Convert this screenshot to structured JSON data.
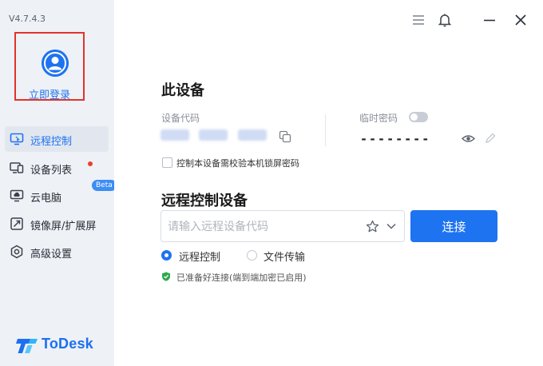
{
  "app": {
    "version": "V4.7.4.3",
    "brand_name": "ToDesk",
    "colors": {
      "accent": "#1e73f0",
      "sidebar_bg": "#eef1f6",
      "highlight_box": "#e2332b",
      "badge_red": "#e8412e",
      "status_green": "#2fa84f"
    }
  },
  "sidebar": {
    "login_label": "立即登录",
    "items": [
      {
        "label": "远程控制",
        "icon": "monitor-icon",
        "active": true
      },
      {
        "label": "设备列表",
        "icon": "devices-icon",
        "badge": "red-dot"
      },
      {
        "label": "云电脑",
        "icon": "cloud-pc-icon",
        "tag": "Beta"
      },
      {
        "label": "镜像屏/扩展屏",
        "icon": "mirror-screen-icon"
      },
      {
        "label": "高级设置",
        "icon": "settings-icon"
      }
    ]
  },
  "topbar": {
    "icons": [
      "menu-icon",
      "bell-icon",
      "minimize-icon",
      "close-icon"
    ]
  },
  "device": {
    "title": "此设备",
    "code_label": "设备代码",
    "temp_password_label": "临时密码",
    "temp_password_value": "--------",
    "temp_password_toggle": false,
    "lock_password_option": "控制本设备需校验本机锁屏密码"
  },
  "remote": {
    "title": "远程控制设备",
    "input_placeholder": "请输入远程设备代码",
    "connect_label": "连接",
    "modes": [
      {
        "label": "远程控制",
        "selected": true
      },
      {
        "label": "文件传输",
        "selected": false
      }
    ],
    "status_text": "已准备好连接(端到端加密已启用)"
  }
}
